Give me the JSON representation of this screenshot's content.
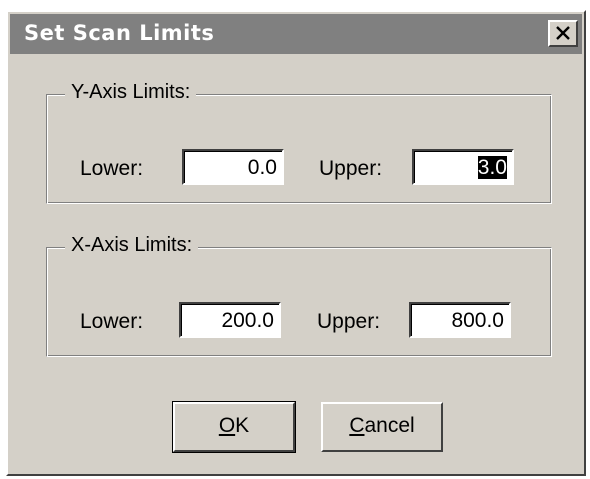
{
  "window": {
    "title": "Set Scan Limits",
    "close_icon": "close-icon"
  },
  "y_axis": {
    "legend": "Y-Axis Limits:",
    "lower_label": "Lower:",
    "lower_value": "0.0",
    "upper_label": "Upper:",
    "upper_value": "3.0",
    "upper_selected": true
  },
  "x_axis": {
    "legend": "X-Axis Limits:",
    "lower_label": "Lower:",
    "lower_value": "200.0",
    "upper_label": "Upper:",
    "upper_value": "800.0"
  },
  "buttons": {
    "ok_mnemonic": "O",
    "ok_rest": "K",
    "cancel_mnemonic": "C",
    "cancel_rest": "ancel"
  },
  "colors": {
    "dialog_face": "#d4d0c8",
    "titlebar": "#808080",
    "selection": "#000000"
  }
}
